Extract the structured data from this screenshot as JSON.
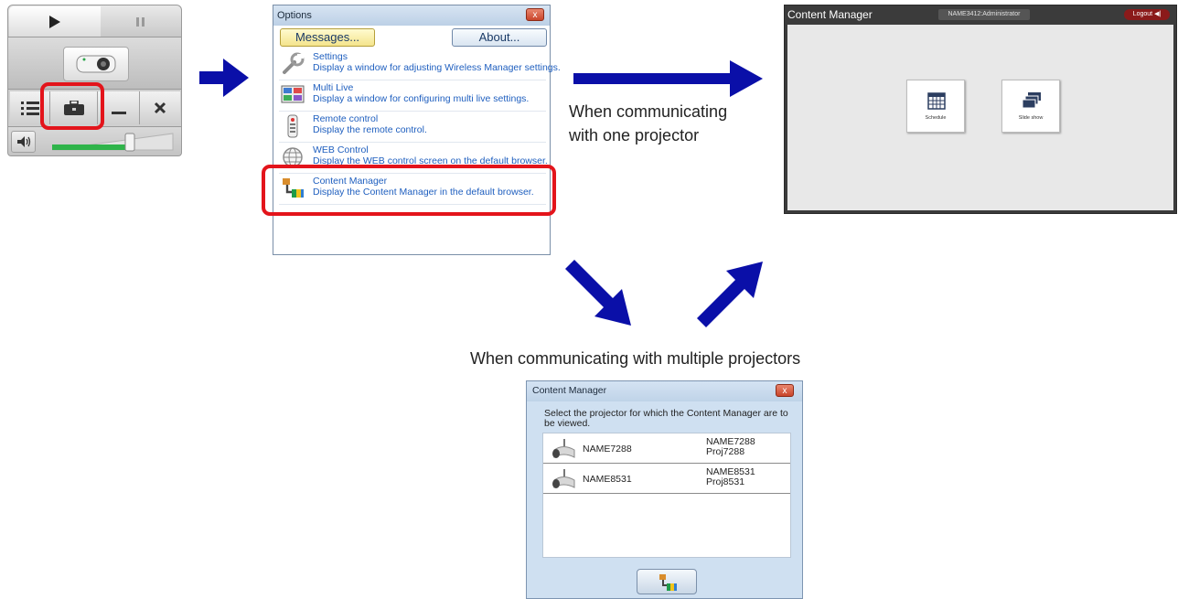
{
  "control_panel": {
    "buttons": [
      "play",
      "pause",
      "projector",
      "list",
      "toolbox",
      "minimize",
      "close",
      "volume"
    ]
  },
  "options_window": {
    "title": "Options",
    "close_label": "x",
    "messages_button": "Messages...",
    "about_button": "About...",
    "items": [
      {
        "title": "Settings",
        "desc": "Display a window for adjusting Wireless Manager settings.",
        "icon": "wrench-icon"
      },
      {
        "title": "Multi Live",
        "desc": "Display a window for configuring multi live settings.",
        "icon": "multi-live-icon"
      },
      {
        "title": "Remote control",
        "desc": "Display the remote control.",
        "icon": "remote-control-icon"
      },
      {
        "title": "WEB Control",
        "desc": "Display the WEB control screen on the default browser.",
        "icon": "globe-icon"
      },
      {
        "title": "Content Manager",
        "desc": "Display the Content Manager in the default browser.",
        "icon": "content-manager-icon"
      }
    ]
  },
  "captions": {
    "one_projector_line1": "When communicating",
    "one_projector_line2": "with one projector",
    "multiple_projectors": "When communicating with multiple projectors"
  },
  "content_manager_web": {
    "title": "Content Manager",
    "user": "NAME3412:Administrator",
    "logout": "Logout",
    "tiles": [
      {
        "label": "Schedule",
        "icon": "calendar-icon"
      },
      {
        "label": "Slide show",
        "icon": "slideshow-icon"
      }
    ]
  },
  "content_manager_dialog": {
    "title": "Content Manager",
    "close_label": "x",
    "message": "Select the projector for which the Content Manager are to be viewed.",
    "rows": [
      {
        "name": "NAME7288",
        "line1": "NAME7288",
        "line2": "Proj7288"
      },
      {
        "name": "NAME8531",
        "line1": "NAME8531",
        "line2": "Proj8531"
      }
    ]
  },
  "colors": {
    "arrow": "#0a0fa8",
    "highlight": "#e3141b",
    "link_text": "#1f5fbf",
    "logout_button": "#8b1a1a"
  }
}
